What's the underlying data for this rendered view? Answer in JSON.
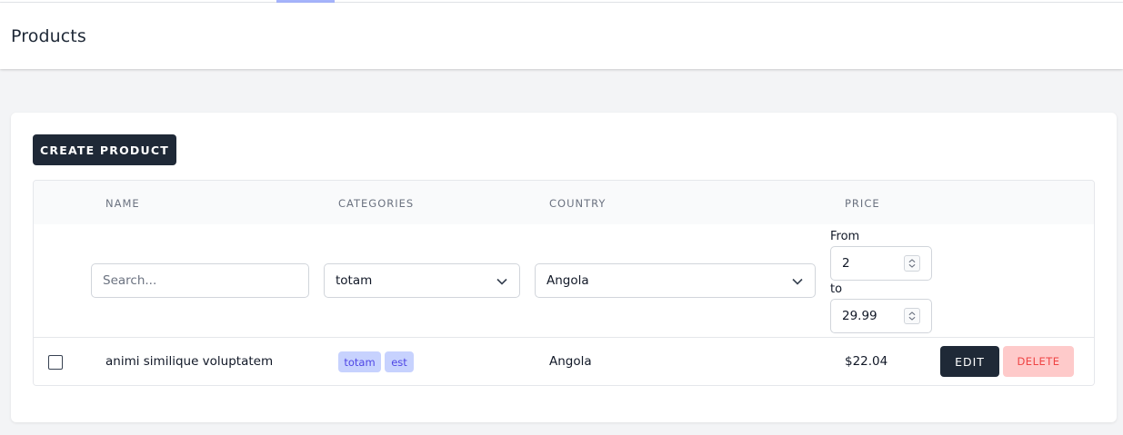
{
  "header": {
    "title": "Products"
  },
  "toolbar": {
    "create_label": "CREATE PRODUCT"
  },
  "table": {
    "columns": [
      "NAME",
      "CATEGORIES",
      "COUNTRY",
      "PRICE"
    ],
    "filters": {
      "search_placeholder": "Search...",
      "search_value": "",
      "category_value": "totam",
      "country_value": "Angola",
      "price_from_label": "From",
      "price_from_value": "2",
      "price_to_label": "to",
      "price_to_value": "29.99"
    },
    "rows": [
      {
        "checked": false,
        "name": "animi similique voluptatem",
        "categories": [
          "totam",
          "est"
        ],
        "country": "Angola",
        "price": "$22.04",
        "edit_label": "EDIT",
        "delete_label": "DELETE"
      }
    ]
  },
  "colors": {
    "primary": "#1f2937",
    "tag_bg": "#c7d2fe",
    "tag_text": "#4f46e5",
    "danger_bg": "#fecaca",
    "danger_text": "#ef4444",
    "nav_indicator": "#a5b4fc"
  },
  "icons": {
    "select_arrow": "chevron-down-icon",
    "number_spinner": "spinner-arrows-icon"
  }
}
